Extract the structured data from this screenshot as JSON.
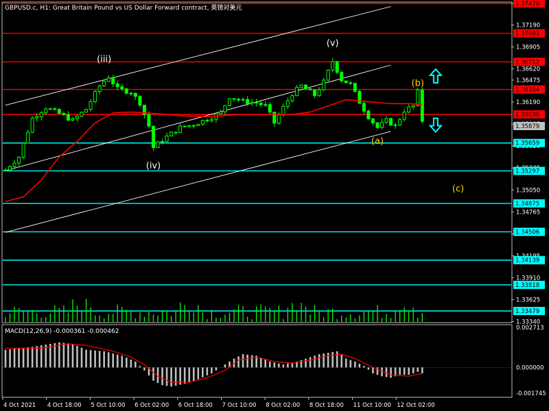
{
  "header": {
    "symbol_title": "GBPUSD.c, H1:  Great Britain Pound vs US Dollar Forward contract, 英镑对美元"
  },
  "macd": {
    "label": "MACD(12,26,9) -0.000361 -0.000462",
    "axis_labels": [
      "0.002713",
      "0.000000",
      "-0.001745"
    ]
  },
  "colors": {
    "background": "#000000",
    "candle": "#00ff00",
    "ma": "#ff0000",
    "resistance": "#ff0000",
    "support": "#00ffff",
    "channel": "#ffffff",
    "wave_white": "#ffffff",
    "wave_yellow": "#ffd700",
    "price_tag_bg": "#c0c0c0"
  },
  "chart_data": {
    "type": "candlestick",
    "y_ticks": [
      1.3747,
      1.3719,
      1.36905,
      1.3662,
      1.36475,
      1.3619,
      1.35905,
      1.3562,
      1.35335,
      1.3505,
      1.34765,
      1.3448,
      1.34195,
      1.3391,
      1.33625,
      1.3334
    ],
    "y_tick_labels": [
      "1.37470",
      "1.37190",
      "1.36905",
      "1.36620",
      "1.36475",
      "1.36190",
      "1.35905",
      "1.35620",
      "1.35335",
      "1.35050",
      "1.34765",
      "1.34480",
      "1.34195",
      "1.33910",
      "1.33625",
      "1.33340"
    ],
    "x_labels": [
      "4 Oct 2021",
      "4 Oct 18:00",
      "5 Oct 10:00",
      "6 Oct 02:00",
      "6 Oct 18:00",
      "7 Oct 10:00",
      "8 Oct 02:00",
      "8 Oct 18:00",
      "11 Oct 10:00",
      "12 Oct 02:00"
    ],
    "current_price": {
      "value": 1.35879,
      "label": "1.35879"
    },
    "resistance_levels": [
      {
        "value": 1.3747,
        "label": "1.37470"
      },
      {
        "value": 1.37083,
        "label": "1.37083"
      },
      {
        "value": 1.36712,
        "label": "1.36712"
      },
      {
        "value": 1.36354,
        "label": "1.36354"
      },
      {
        "value": 1.3603,
        "label": "1.36030"
      }
    ],
    "support_levels": [
      {
        "value": 1.35659,
        "label": "1.35659"
      },
      {
        "value": 1.35297,
        "label": "1.35297"
      },
      {
        "value": 1.34875,
        "label": "1.34875"
      },
      {
        "value": 1.34506,
        "label": "1.34506"
      },
      {
        "value": 1.34139,
        "label": "1.34139"
      },
      {
        "value": 1.33818,
        "label": "1.33818"
      },
      {
        "value": 1.33479,
        "label": "1.33479"
      }
    ],
    "wave_labels": [
      {
        "text": "(iii)",
        "bar": 22,
        "price": 1.3671,
        "color": "white"
      },
      {
        "text": "(iv)",
        "bar": 33,
        "price": 1.3533,
        "color": "white"
      },
      {
        "text": "(v)",
        "bar": 73,
        "price": 1.3692,
        "color": "white"
      },
      {
        "text": "(a)",
        "bar": 83,
        "price": 1.3565,
        "color": "yellow"
      },
      {
        "text": "(b)",
        "bar": 92,
        "price": 1.364,
        "color": "yellow"
      },
      {
        "text": "(c)",
        "bar": 101,
        "price": 1.3503,
        "color": "yellow"
      }
    ],
    "close_path": [
      [
        0,
        1.3531
      ],
      [
        3,
        1.3548
      ],
      [
        6,
        1.3598
      ],
      [
        9,
        1.3612
      ],
      [
        12,
        1.3604
      ],
      [
        15,
        1.3595
      ],
      [
        18,
        1.361
      ],
      [
        21,
        1.364
      ],
      [
        23,
        1.3652
      ],
      [
        25,
        1.3636
      ],
      [
        28,
        1.3632
      ],
      [
        30,
        1.3618
      ],
      [
        32,
        1.3588
      ],
      [
        33,
        1.356
      ],
      [
        35,
        1.357
      ],
      [
        37,
        1.3578
      ],
      [
        39,
        1.3586
      ],
      [
        42,
        1.359
      ],
      [
        45,
        1.3597
      ],
      [
        48,
        1.3605
      ],
      [
        50,
        1.3626
      ],
      [
        53,
        1.362
      ],
      [
        56,
        1.3618
      ],
      [
        58,
        1.3614
      ],
      [
        60,
        1.3592
      ],
      [
        62,
        1.3612
      ],
      [
        64,
        1.363
      ],
      [
        66,
        1.364
      ],
      [
        69,
        1.3628
      ],
      [
        71,
        1.3645
      ],
      [
        73,
        1.3672
      ],
      [
        75,
        1.3648
      ],
      [
        77,
        1.3642
      ],
      [
        79,
        1.3619
      ],
      [
        81,
        1.36
      ],
      [
        83,
        1.3586
      ],
      [
        85,
        1.3595
      ],
      [
        87,
        1.3588
      ],
      [
        89,
        1.3608
      ],
      [
        91,
        1.3614
      ],
      [
        92,
        1.3632
      ],
      [
        93,
        1.3595
      ]
    ],
    "ma_path": [
      [
        0,
        1.349
      ],
      [
        4,
        1.3496
      ],
      [
        8,
        1.3518
      ],
      [
        12,
        1.3548
      ],
      [
        16,
        1.3568
      ],
      [
        20,
        1.3592
      ],
      [
        24,
        1.3605
      ],
      [
        28,
        1.3606
      ],
      [
        34,
        1.3604
      ],
      [
        40,
        1.3601
      ],
      [
        46,
        1.36
      ],
      [
        52,
        1.3603
      ],
      [
        58,
        1.3603
      ],
      [
        64,
        1.3603
      ],
      [
        68,
        1.3606
      ],
      [
        72,
        1.3614
      ],
      [
        76,
        1.3622
      ],
      [
        80,
        1.362
      ],
      [
        86,
        1.3617
      ],
      [
        90,
        1.3617
      ],
      [
        93,
        1.3616
      ]
    ],
    "channel_lines": [
      {
        "x1": 0,
        "y1": 1.3615,
        "x2": 86,
        "y2": 1.3743
      },
      {
        "x1": 0,
        "y1": 1.353,
        "x2": 86,
        "y2": 1.3667
      },
      {
        "x1": 0,
        "y1": 1.345,
        "x2": 86,
        "y2": 1.3581
      }
    ],
    "arrows": [
      {
        "direction": "up",
        "bar": 96,
        "price": 1.3652
      },
      {
        "direction": "down",
        "bar": 96,
        "price": 1.359
      }
    ],
    "macd": {
      "ylim": [
        -0.001745,
        0.002713
      ],
      "histogram_path": [
        [
          0,
          0.0012
        ],
        [
          6,
          0.0014
        ],
        [
          12,
          0.0017
        ],
        [
          15,
          0.0016
        ],
        [
          18,
          0.0012
        ],
        [
          22,
          0.0011
        ],
        [
          26,
          0.0008
        ],
        [
          29,
          0.0004
        ],
        [
          31,
          -0.0002
        ],
        [
          33,
          -0.0009
        ],
        [
          35,
          -0.0012
        ],
        [
          37,
          -0.0013
        ],
        [
          40,
          -0.0011
        ],
        [
          43,
          -0.0008
        ],
        [
          46,
          -0.0004
        ],
        [
          49,
          0.0002
        ],
        [
          51,
          0.0006
        ],
        [
          53,
          0.0009
        ],
        [
          56,
          0.0008
        ],
        [
          59,
          0.0004
        ],
        [
          62,
          0.0002
        ],
        [
          65,
          0.0004
        ],
        [
          68,
          0.0007
        ],
        [
          70,
          0.0009
        ],
        [
          72,
          0.001
        ],
        [
          74,
          0.0011
        ],
        [
          76,
          0.0006
        ],
        [
          78,
          0.0004
        ],
        [
          80,
          0.0001
        ],
        [
          82,
          -0.0004
        ],
        [
          84,
          -0.0006
        ],
        [
          86,
          -0.0007
        ],
        [
          88,
          -0.0005
        ],
        [
          90,
          -0.0005
        ],
        [
          92,
          -0.0003
        ],
        [
          93,
          -0.0004
        ]
      ],
      "signal_path": [
        [
          0,
          0.0013
        ],
        [
          8,
          0.0013
        ],
        [
          14,
          0.0016
        ],
        [
          18,
          0.0015
        ],
        [
          24,
          0.0011
        ],
        [
          28,
          0.0007
        ],
        [
          31,
          0.0002
        ],
        [
          34,
          -0.0006
        ],
        [
          37,
          -0.001
        ],
        [
          41,
          -0.001
        ],
        [
          45,
          -0.0007
        ],
        [
          49,
          -0.0002
        ],
        [
          52,
          0.0005
        ],
        [
          56,
          0.0007
        ],
        [
          60,
          0.0004
        ],
        [
          64,
          0.0003
        ],
        [
          68,
          0.0005
        ],
        [
          72,
          0.0008
        ],
        [
          75,
          0.0009
        ],
        [
          78,
          0.0006
        ],
        [
          82,
          0.0
        ],
        [
          86,
          -0.0005
        ],
        [
          90,
          -0.0006
        ],
        [
          93,
          -0.0004
        ]
      ]
    }
  }
}
